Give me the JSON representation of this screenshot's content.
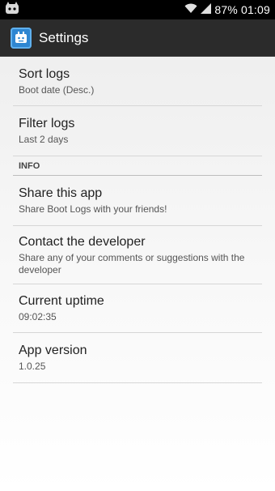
{
  "status_bar": {
    "battery_percent": "87%",
    "time": "01:09"
  },
  "action_bar": {
    "title": "Settings"
  },
  "preferences": {
    "sort_logs": {
      "title": "Sort logs",
      "summary": "Boot date (Desc.)"
    },
    "filter_logs": {
      "title": "Filter logs",
      "summary": "Last 2 days"
    },
    "info_category": "INFO",
    "share_app": {
      "title": "Share this app",
      "summary": "Share Boot Logs with your friends!"
    },
    "contact_dev": {
      "title": "Contact the developer",
      "summary": "Share any of your comments or suggestions with the developer"
    },
    "uptime": {
      "title": "Current uptime",
      "summary": "09:02:35"
    },
    "version": {
      "title": "App version",
      "summary": "1.0.25"
    }
  }
}
